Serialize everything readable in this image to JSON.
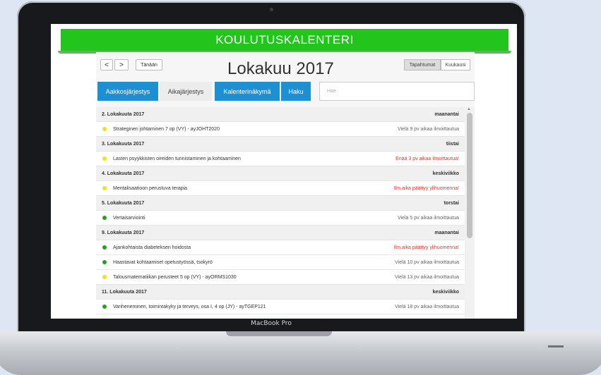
{
  "device": {
    "label": "MacBook Pro"
  },
  "app": {
    "title": "KOULUTUSKALENTERI"
  },
  "toolbar": {
    "prev_label": "<",
    "next_label": ">",
    "today_label": "Tänään",
    "month_title": "Lokakuu 2017",
    "view_options": [
      "Tapahtumat",
      "Kuukausi"
    ],
    "active_view": "Tapahtumat"
  },
  "tabs": [
    {
      "label": "Aakkosjärjestys",
      "style": "blue"
    },
    {
      "label": "Aikajärjestys",
      "style": "plain"
    },
    {
      "label": "Kalenterinäkymä",
      "style": "blue"
    },
    {
      "label": "Haku",
      "style": "blue"
    }
  ],
  "search": {
    "placeholder": "Hae"
  },
  "colors": {
    "banner_green": "#22c51b",
    "tab_blue": "#1d8fd3",
    "status_red": "#e5332a",
    "dot_yellow": "#f4e01a",
    "dot_green": "#22a11c"
  },
  "rows": [
    {
      "type": "date",
      "left": "2. Lokakuuta 2017",
      "right": "maanantai"
    },
    {
      "type": "event",
      "dot": "yellow",
      "left": "Strateginen johtaminen 7 op (VY) - ayJOHT2020",
      "right": "Vielä 9 pv aikaa ilmoittautua",
      "status": "gray"
    },
    {
      "type": "date",
      "left": "3. Lokakuuta 2017",
      "right": "tiistai"
    },
    {
      "type": "event",
      "dot": "yellow",
      "left": "Lasten psyykkisten oireiden tunnistaminen ja kohtaaminen",
      "right": "Enää 3 pv aikaa ilmoittautua!",
      "status": "red"
    },
    {
      "type": "date",
      "left": "4. Lokakuuta 2017",
      "right": "keskiviikko"
    },
    {
      "type": "event",
      "dot": "yellow",
      "left": "Mentalisaatioon perustuva terapia",
      "right": "Ilm.aika päättyy ylihuomenna!",
      "status": "red"
    },
    {
      "type": "date",
      "left": "5. Lokakuuta 2017",
      "right": "torstai"
    },
    {
      "type": "event",
      "dot": "green",
      "left": "Vertaisarviointi",
      "right": "Vielä 5 pv aikaa ilmoittautua",
      "status": "gray"
    },
    {
      "type": "date",
      "left": "9. Lokakuuta 2017",
      "right": "maanantai"
    },
    {
      "type": "event",
      "dot": "green",
      "left": "Ajankohtaista diabeteksen hoidosta",
      "right": "Ilm.aika päättyy ylihuomenna!",
      "status": "red"
    },
    {
      "type": "event",
      "dot": "green",
      "left": "Haastavat kohtaamiset opetustyössä, tsokyrö",
      "right": "Vielä 10 pv aikaa ilmoittautua",
      "status": "gray"
    },
    {
      "type": "event",
      "dot": "yellow",
      "left": "Talousmatematiikan perusteet 5 op (VY) - ayORMS1030",
      "right": "Vielä 13 pv aikaa ilmoittautua",
      "status": "gray"
    },
    {
      "type": "date",
      "left": "11. Lokakuuta 2017",
      "right": "keskiviikko"
    },
    {
      "type": "event",
      "dot": "green",
      "left": "Vanheneminen, toimintakyky ja terveys, osa I, 4 op (JY) - ayTGEP121",
      "right": "Vielä 18 pv aikaa ilmoittautua",
      "status": "gray"
    }
  ]
}
